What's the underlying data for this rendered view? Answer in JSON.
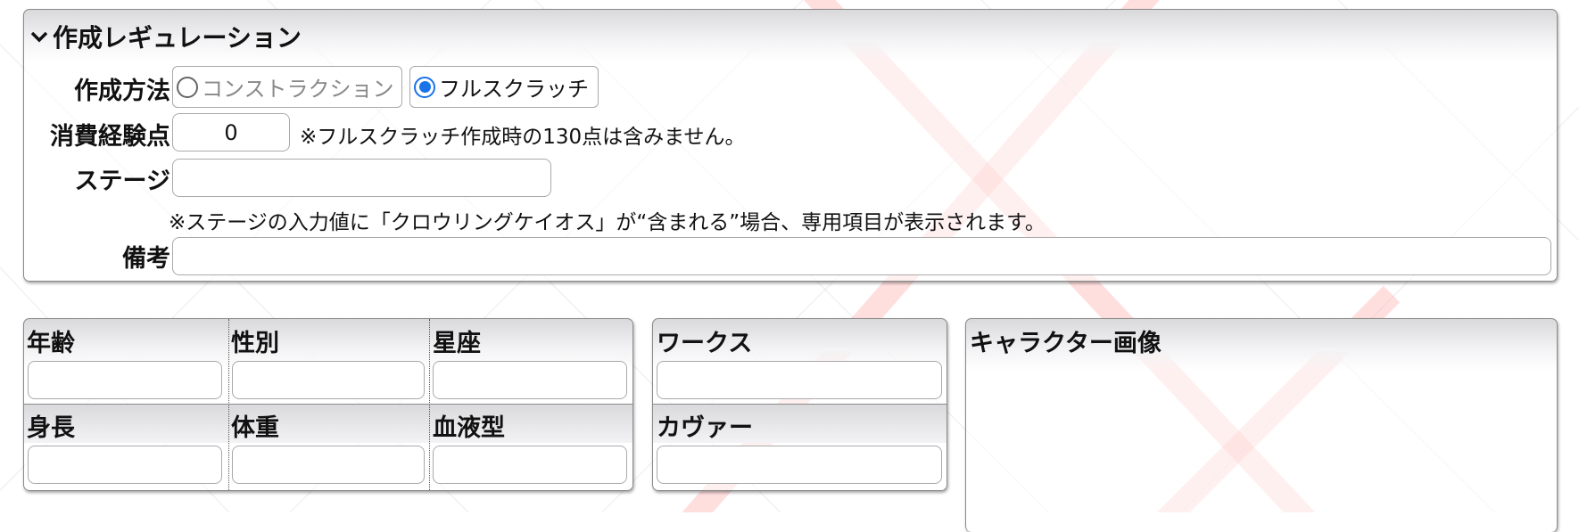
{
  "regulation": {
    "title": "作成レギュレーション",
    "method_label": "作成方法",
    "method_options": [
      {
        "label": "コンストラクション",
        "selected": false,
        "disabled": true
      },
      {
        "label": "フルスクラッチ",
        "selected": true,
        "disabled": false
      }
    ],
    "exp_label": "消費経験点",
    "exp_value": "0",
    "exp_note": "※フルスクラッチ作成時の130点は含みません。",
    "stage_label": "ステージ",
    "stage_value": "",
    "stage_note": "※ステージの入力値に「クロウリングケイオス」が“含まれる”場合、専用項目が表示されます。",
    "remarks_label": "備考",
    "remarks_value": ""
  },
  "profile": {
    "age_label": "年齢",
    "gender_label": "性別",
    "sign_label": "星座",
    "height_label": "身長",
    "weight_label": "体重",
    "blood_label": "血液型"
  },
  "works": {
    "works_label": "ワークス",
    "cover_label": "カヴァー"
  },
  "character_image": {
    "title": "キャラクター画像"
  },
  "colors": {
    "accent": "#1a73e8",
    "bg_pattern": "#ff4d4d"
  }
}
